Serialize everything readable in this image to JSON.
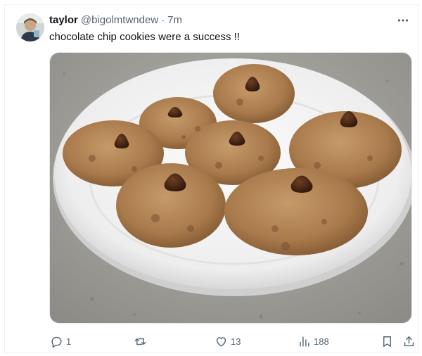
{
  "tweet": {
    "display_name": "taylor",
    "handle": "@bigolmtwndew",
    "separator": "·",
    "time": "7m",
    "text": "chocolate chip cookies were a success !!",
    "media_alt": "Plate of chocolate chip cookies each topped with a chocolate kiss"
  },
  "actions": {
    "reply_count": "1",
    "repost_count": "",
    "like_count": "13",
    "view_count": "188"
  },
  "icons": {
    "more": "more-horizontal-icon",
    "reply": "reply-icon",
    "repost": "repost-icon",
    "like": "heart-icon",
    "views": "analytics-icon",
    "bookmark": "bookmark-icon",
    "share": "share-icon"
  },
  "colors": {
    "text_primary": "#0f1419",
    "text_secondary": "#536471",
    "border": "#eff3f4"
  }
}
